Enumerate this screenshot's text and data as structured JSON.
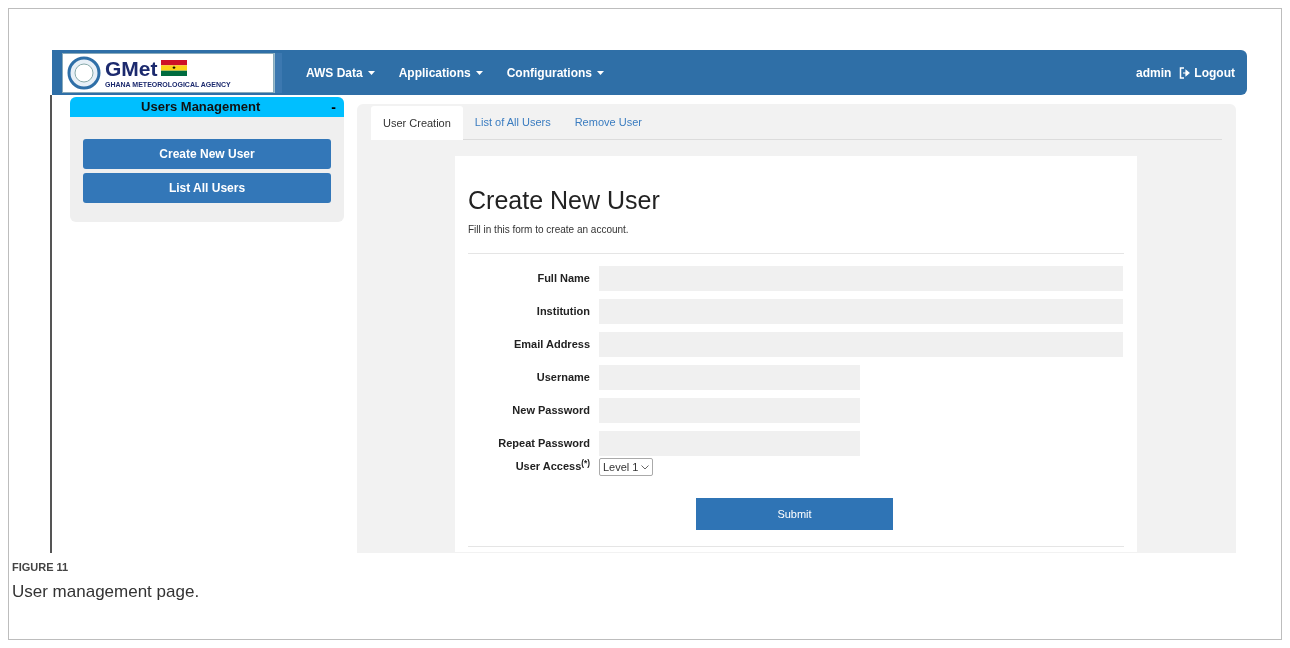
{
  "navbar": {
    "logo": {
      "title": "GMet",
      "subtitle": "GHANA METEOROLOGICAL AGENCY"
    },
    "menus": [
      {
        "label": "AWS Data"
      },
      {
        "label": "Applications"
      },
      {
        "label": "Configurations"
      }
    ],
    "user": "admin",
    "logout": "Logout"
  },
  "sidebar": {
    "title": "Users Management",
    "toggle": "-",
    "buttons": [
      "Create New User",
      "List All Users"
    ]
  },
  "tabs": [
    {
      "label": "User Creation",
      "selected": true
    },
    {
      "label": "List of All Users",
      "selected": false
    },
    {
      "label": "Remove User",
      "selected": false
    }
  ],
  "form": {
    "title": "Create New User",
    "subtitle": "Fill in this form to create an account.",
    "fields": [
      {
        "label": "Full Name",
        "kind": "wide"
      },
      {
        "label": "Institution",
        "kind": "wide"
      },
      {
        "label": "Email Address",
        "kind": "wide"
      },
      {
        "label": "Username",
        "kind": "short"
      },
      {
        "label": "New Password",
        "kind": "short"
      },
      {
        "label": "Repeat Password",
        "kind": "short"
      },
      {
        "label": "User Access$^{(*)}$",
        "kind": "select",
        "value": "Level 1"
      }
    ],
    "submit": "Submit"
  },
  "caption": {
    "label": "FIGURE 11",
    "text": "User management page."
  }
}
